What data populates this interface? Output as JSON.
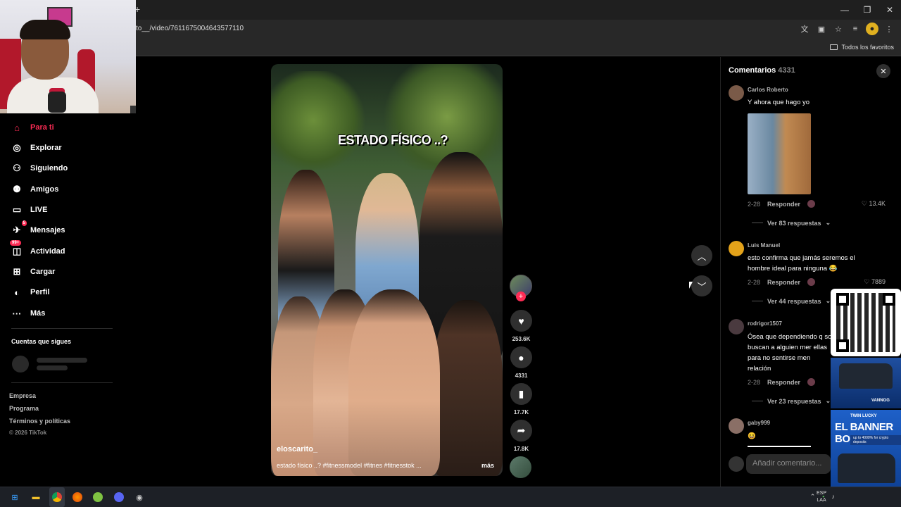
{
  "browser": {
    "url": "to__/video/7611675004643577110",
    "bookmarks_label": "Todos los favoritos",
    "new_tab_symbol": "+",
    "window_controls": [
      "—",
      "❐",
      "✕"
    ]
  },
  "sidebar": {
    "items": [
      {
        "label": "Para ti",
        "icon": "home-icon",
        "glyph": "⌂"
      },
      {
        "label": "Explorar",
        "icon": "compass-icon",
        "glyph": "◎"
      },
      {
        "label": "Siguiendo",
        "icon": "following-icon",
        "glyph": "⚇"
      },
      {
        "label": "Amigos",
        "icon": "friends-icon",
        "glyph": "⚉"
      },
      {
        "label": "LIVE",
        "icon": "live-icon",
        "glyph": "▭"
      },
      {
        "label": "Mensajes",
        "icon": "messages-icon",
        "glyph": "✈",
        "badge": "5"
      },
      {
        "label": "Actividad",
        "icon": "activity-icon",
        "glyph": "◫",
        "badge": "99+"
      },
      {
        "label": "Cargar",
        "icon": "upload-icon",
        "glyph": "⊞"
      },
      {
        "label": "Perfil",
        "icon": "profile-icon",
        "glyph": "◐"
      },
      {
        "label": "Más",
        "icon": "more-icon",
        "glyph": "···"
      }
    ],
    "following_title": "Cuentas que sigues",
    "footer_links": [
      "Empresa",
      "Programa",
      "Términos y políticas"
    ],
    "copyright": "© 2026 TikTok"
  },
  "video": {
    "overlay_title": "ESTADO FÍSICO ..?",
    "author": "eloscarito_",
    "description": "estado físico ..? #fitnessmodel #fitnes #fitnesstok ...",
    "more_label": "más"
  },
  "actions": {
    "likes": "253.6K",
    "comments": "4331",
    "saves": "17.7K",
    "shares": "17.8K"
  },
  "comments_panel": {
    "title": "Comentarios",
    "count": "4331",
    "input_placeholder": "Añadir comentario...",
    "items": [
      {
        "user": "Carlos Roberto",
        "text": "Y ahora que hago yo",
        "date": "2-28",
        "reply": "Responder",
        "likes": "13.4K",
        "replies": "Ver 83 respuestas"
      },
      {
        "user": "Luis Manuel",
        "text": "esto confirma que jamás seremos el hombre ideal para ninguna 😂",
        "date": "2-28",
        "reply": "Responder",
        "likes": "7889",
        "replies": "Ver 44 respuestas"
      },
      {
        "user": "rodrigor1507",
        "text": "Ósea que dependiendo q son buscan a alguien mer ellas para no sentirse men relación",
        "date": "2-28",
        "reply": "Responder",
        "replies": "Ver 23 respuestas"
      },
      {
        "user": "gaby999",
        "text": "😆"
      }
    ]
  },
  "ads": {
    "qr": "",
    "banner_small": "TWIN LUCKY",
    "banner_title": "EL BANNER BONO",
    "banner_sub": "up to 4000% for crypto deposits",
    "brand": "VANNGG"
  },
  "taskbar": {
    "lang_top": "ESP",
    "lang_bottom": "LAA"
  },
  "colors": {
    "accent": "#fe2c55",
    "background": "#000000",
    "panel": "#2f2f2f"
  }
}
